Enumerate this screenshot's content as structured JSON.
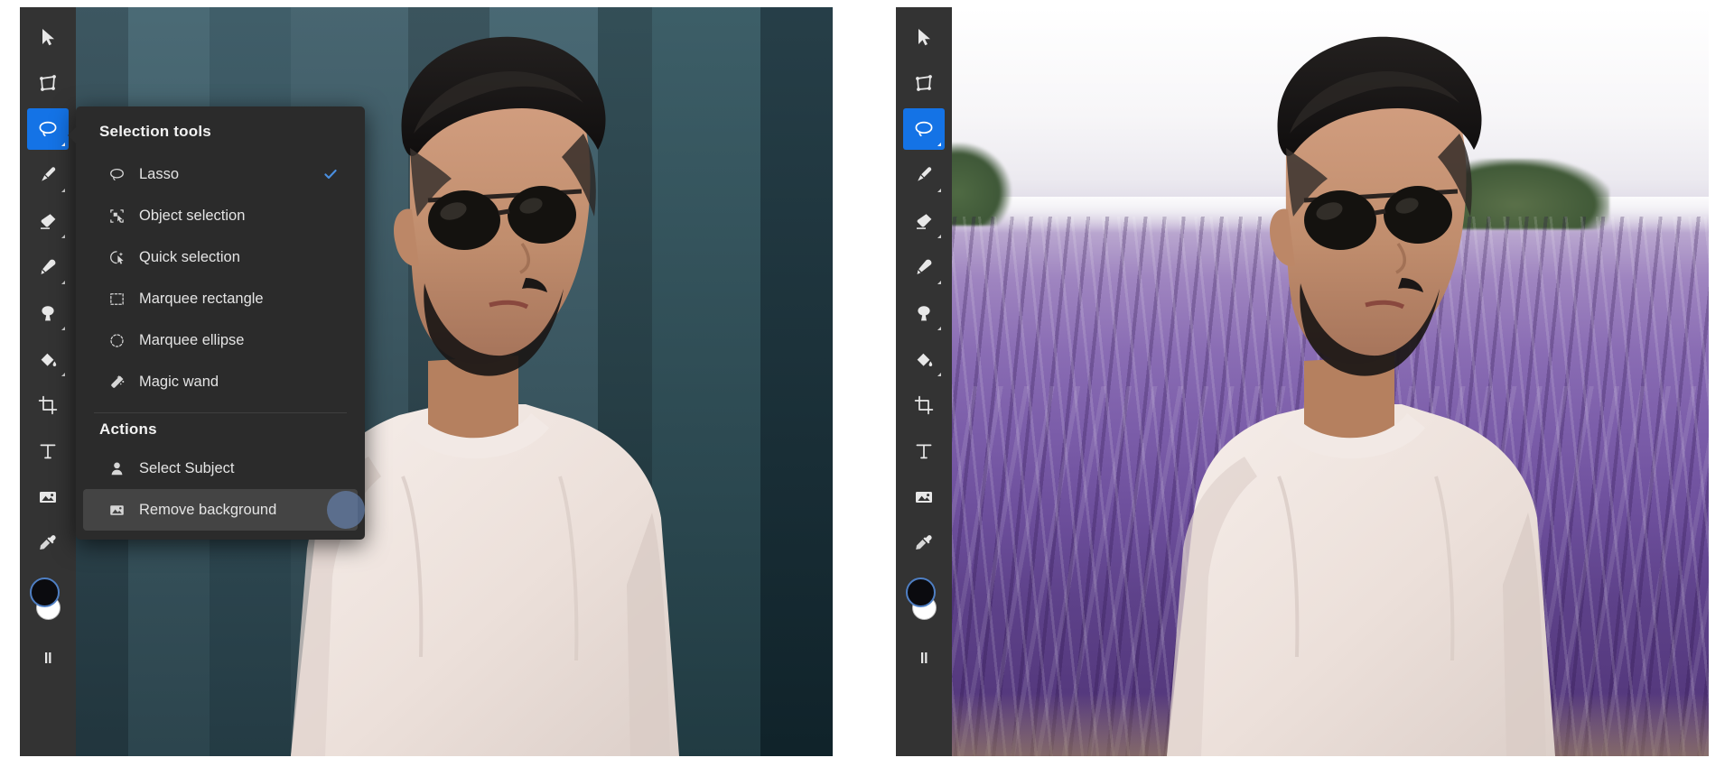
{
  "app": {
    "accent_blue": "#1473e6",
    "menu_bg": "#2b2b2b",
    "toolbar_bg": "#333333",
    "highlight_bg": "#444444",
    "check_color": "#4a8fe0"
  },
  "toolbar": {
    "tools": [
      {
        "name": "move-tool",
        "icon": "cursor-arrow-icon",
        "has_flyout": false,
        "active": false
      },
      {
        "name": "transform-tool",
        "icon": "transform-icon",
        "has_flyout": false,
        "active": false
      },
      {
        "name": "lasso-selection-tool",
        "icon": "lasso-icon",
        "has_flyout": true,
        "active": true
      },
      {
        "name": "brush-tool",
        "icon": "paintbrush-icon",
        "has_flyout": true,
        "active": false
      },
      {
        "name": "eraser-tool",
        "icon": "eraser-icon",
        "has_flyout": true,
        "active": false
      },
      {
        "name": "healing-tool",
        "icon": "healing-brush-icon",
        "has_flyout": true,
        "active": false
      },
      {
        "name": "clone-stamp-tool",
        "icon": "clone-stamp-icon",
        "has_flyout": true,
        "active": false
      },
      {
        "name": "paint-bucket-tool",
        "icon": "paint-bucket-icon",
        "has_flyout": true,
        "active": false
      },
      {
        "name": "crop-tool",
        "icon": "crop-icon",
        "has_flyout": false,
        "active": false
      },
      {
        "name": "text-tool",
        "icon": "text-t-icon",
        "has_flyout": false,
        "active": false
      },
      {
        "name": "place-image-tool",
        "icon": "image-icon",
        "has_flyout": false,
        "active": false
      },
      {
        "name": "eyedropper-tool",
        "icon": "eyedropper-icon",
        "has_flyout": false,
        "active": false
      }
    ],
    "swatches": {
      "foreground_color": "#0b0b0f",
      "background_color": "#ffffff",
      "swap_icon": "swap-colors-icon"
    }
  },
  "flyout_menu": {
    "heading": "Selection tools",
    "items": [
      {
        "label": "Lasso",
        "icon": "lasso-icon",
        "checked": true,
        "highlighted": false
      },
      {
        "label": "Object selection",
        "icon": "object-selection-icon",
        "checked": false,
        "highlighted": false
      },
      {
        "label": "Quick selection",
        "icon": "quick-selection-icon",
        "checked": false,
        "highlighted": false
      },
      {
        "label": "Marquee rectangle",
        "icon": "marquee-rectangle-icon",
        "checked": false,
        "highlighted": false
      },
      {
        "label": "Marquee ellipse",
        "icon": "marquee-ellipse-icon",
        "checked": false,
        "highlighted": false
      },
      {
        "label": "Magic wand",
        "icon": "magic-wand-icon",
        "checked": false,
        "highlighted": false
      }
    ],
    "actions_heading": "Actions",
    "actions": [
      {
        "label": "Select Subject",
        "icon": "person-icon",
        "checked": false,
        "highlighted": false
      },
      {
        "label": "Remove background",
        "icon": "image-icon",
        "checked": false,
        "highlighted": true
      }
    ]
  },
  "panels": [
    {
      "name": "before-panel",
      "state": "original-photo-with-menu-open",
      "background_description": "dark teal wall"
    },
    {
      "name": "after-panel",
      "state": "background-replaced-with-lavender-field",
      "background_description": "lavender field"
    }
  ]
}
